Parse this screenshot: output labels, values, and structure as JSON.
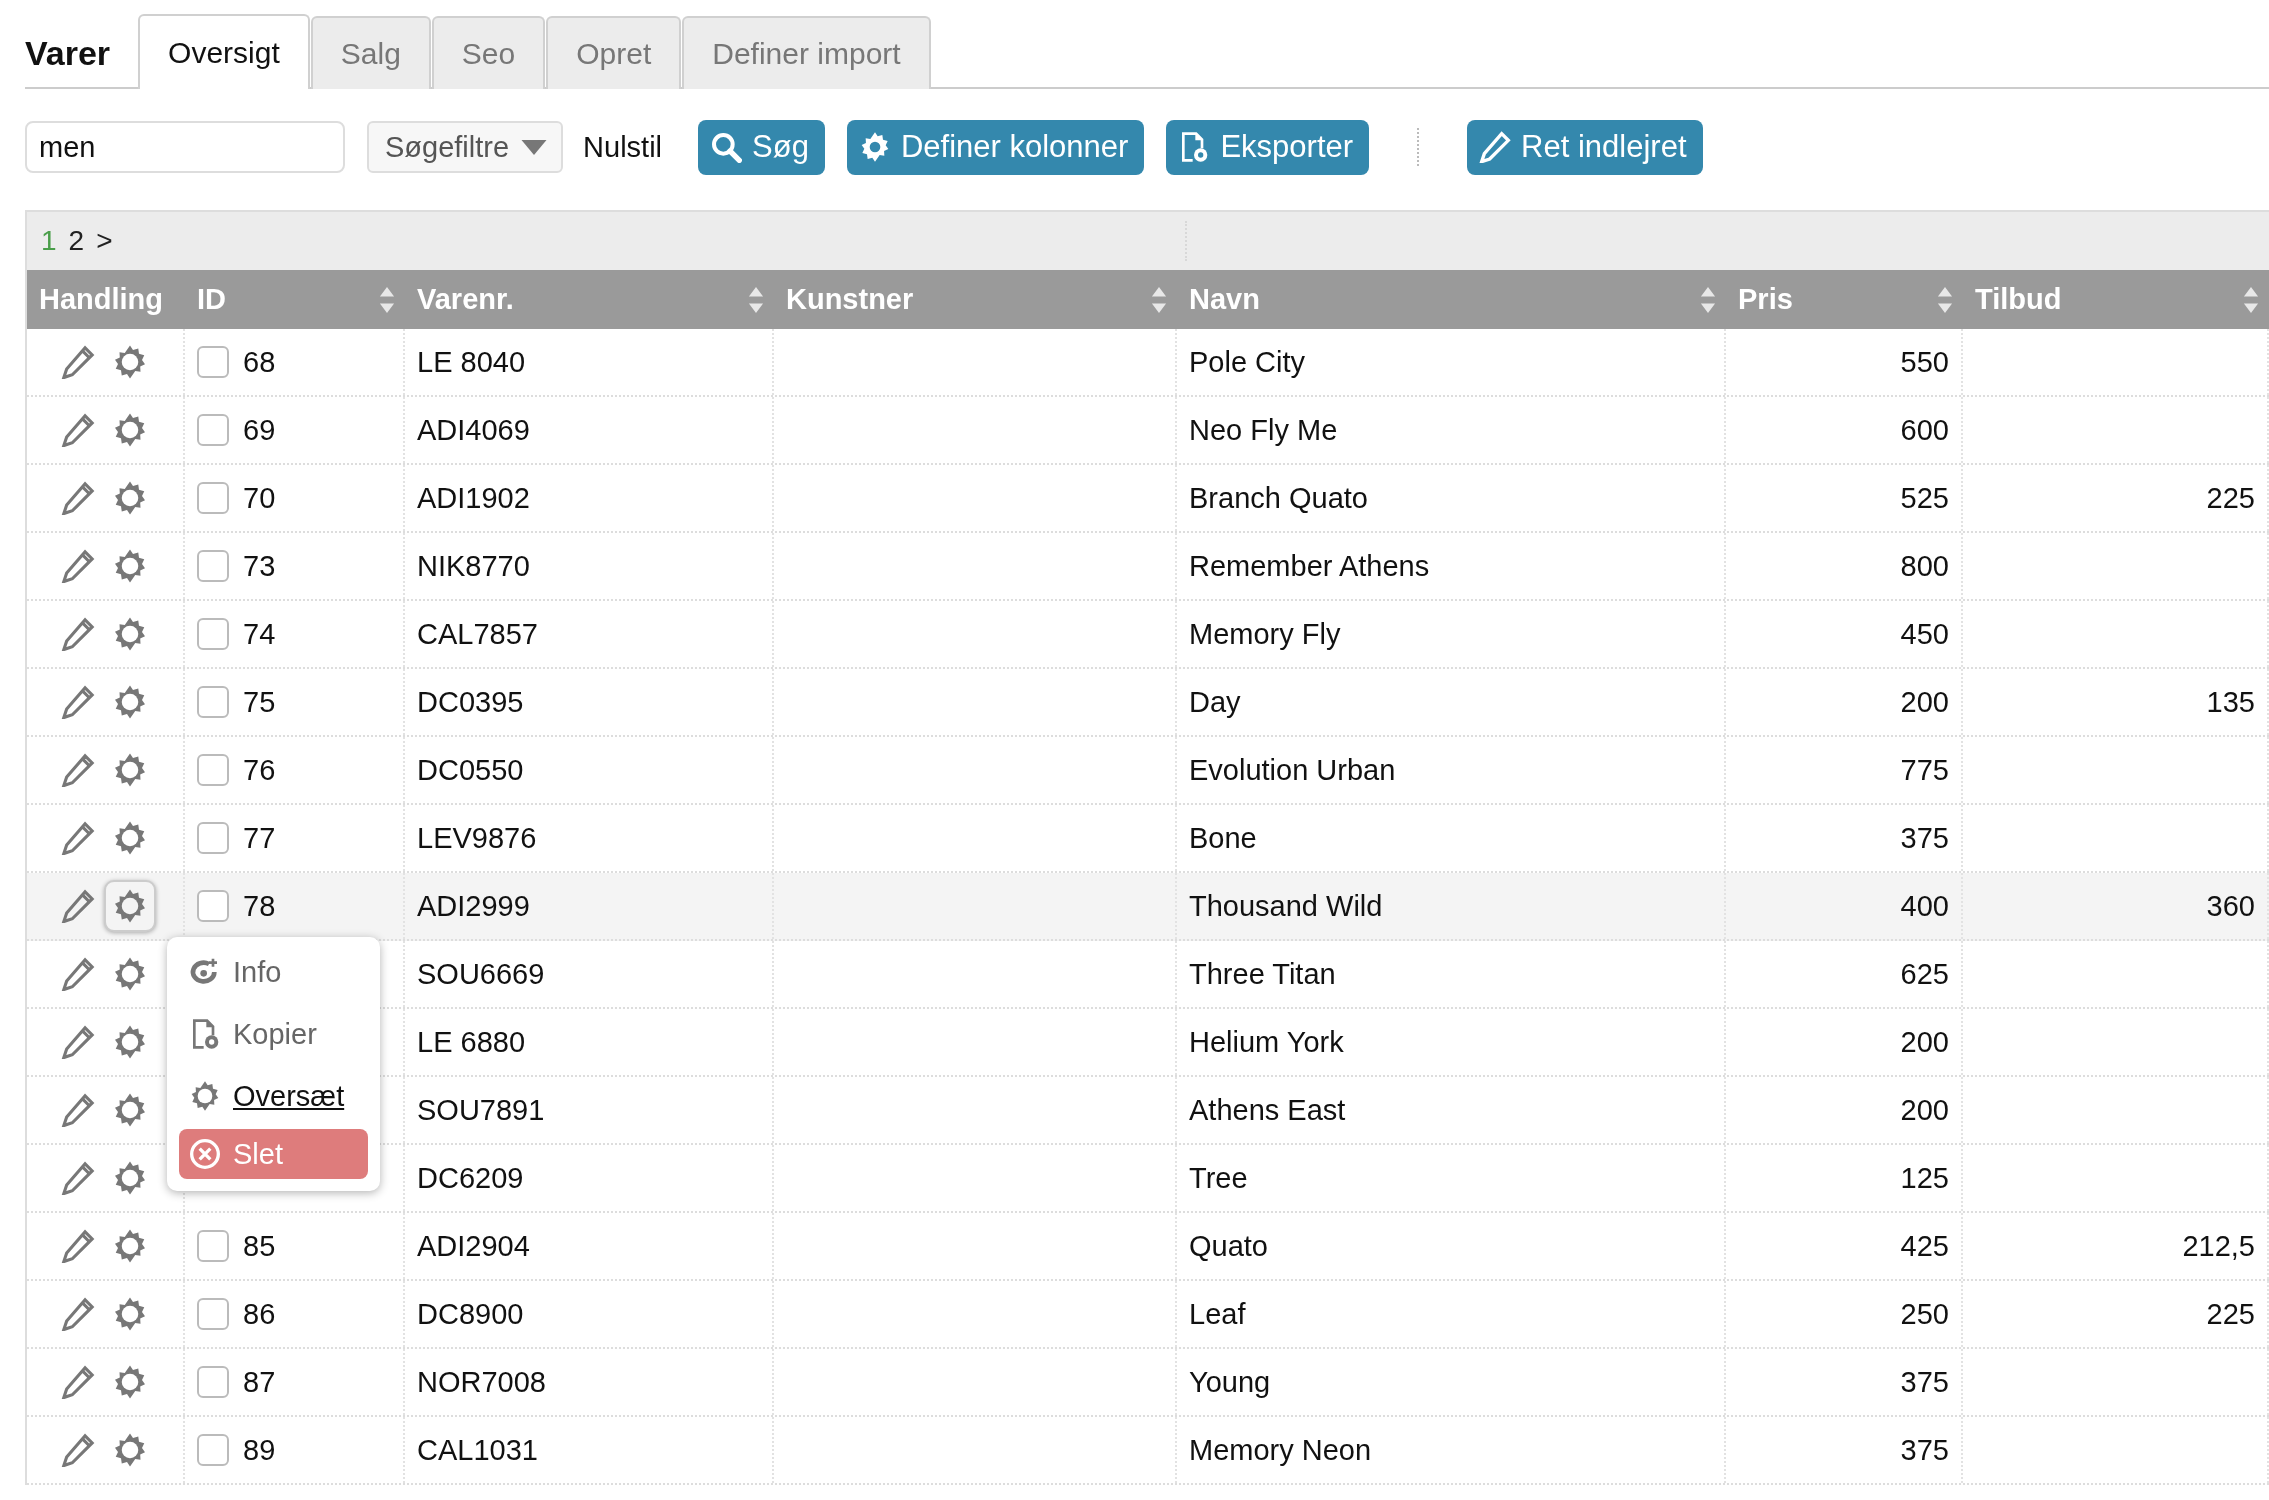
{
  "title": "Varer",
  "tabs": [
    {
      "label": "Oversigt",
      "selected": true
    },
    {
      "label": "Salg",
      "selected": false
    },
    {
      "label": "Seo",
      "selected": false
    },
    {
      "label": "Opret",
      "selected": false
    },
    {
      "label": "Definer import",
      "selected": false
    }
  ],
  "search": {
    "value": "men"
  },
  "filter_dropdown": {
    "label": "Søgefiltre"
  },
  "reset_link": "Nulstil",
  "buttons": [
    {
      "kind": "search",
      "label": "Søg"
    },
    {
      "kind": "columns",
      "label": "Definer kolonner"
    },
    {
      "kind": "export",
      "label": "Eksporter"
    },
    {
      "kind": "separator"
    },
    {
      "kind": "edit",
      "label": "Ret indlejret"
    }
  ],
  "pager": [
    {
      "label": "1",
      "selected": true
    },
    {
      "label": "2",
      "selected": false
    },
    {
      "label": ">",
      "selected": false
    }
  ],
  "columns": [
    {
      "label": "Handling",
      "sortable": false
    },
    {
      "label": "ID",
      "sortable": true
    },
    {
      "label": "Varenr.",
      "sortable": true
    },
    {
      "label": "Kunstner",
      "sortable": true
    },
    {
      "label": "Navn",
      "sortable": true
    },
    {
      "label": "Pris",
      "sortable": true
    },
    {
      "label": "Tilbud",
      "sortable": true
    }
  ],
  "rows": [
    {
      "id": "68",
      "varenr": "LE 8040",
      "navn": "Pole City",
      "pris": "550",
      "checked": false,
      "selected": false
    },
    {
      "id": "69",
      "varenr": "ADI4069",
      "navn": "Neo Fly Me",
      "pris": "600",
      "checked": false,
      "selected": false
    },
    {
      "id": "70",
      "varenr": "ADI1902",
      "navn": "Branch Quato",
      "pris": "525",
      "tilbud": "225",
      "checked": false,
      "selected": false
    },
    {
      "id": "73",
      "varenr": "NIK8770",
      "navn": "Remember Athens",
      "pris": "800",
      "checked": false,
      "selected": false
    },
    {
      "id": "74",
      "varenr": "CAL7857",
      "navn": "Memory Fly",
      "pris": "450",
      "checked": false,
      "selected": false
    },
    {
      "id": "75",
      "varenr": "DC0395",
      "navn": "Day",
      "pris": "200",
      "tilbud": "135",
      "checked": false,
      "selected": false
    },
    {
      "id": "76",
      "varenr": "DC0550",
      "navn": "Evolution Urban",
      "pris": "775",
      "checked": false,
      "selected": false
    },
    {
      "id": "77",
      "varenr": "LEV9876",
      "navn": "Bone",
      "pris": "375",
      "checked": false,
      "selected": false
    },
    {
      "id": "78",
      "varenr": "ADI2999",
      "navn": "Thousand Wild",
      "pris": "400",
      "tilbud": "360",
      "checked": false,
      "selected": true
    },
    {
      "varenr": "SOU6669",
      "navn": "Three Titan",
      "pris": "625",
      "selected": false
    },
    {
      "varenr": "LE 6880",
      "navn": "Helium York",
      "pris": "200",
      "selected": false
    },
    {
      "varenr": "SOU7891",
      "navn": "Athens East",
      "pris": "200",
      "selected": false
    },
    {
      "varenr": "DC6209",
      "navn": "Tree",
      "pris": "125",
      "selected": false
    },
    {
      "id": "85",
      "varenr": "ADI2904",
      "navn": "Quato",
      "pris": "425",
      "tilbud": "212,5",
      "checked": false,
      "selected": false
    },
    {
      "id": "86",
      "varenr": "DC8900",
      "navn": "Leaf",
      "pris": "250",
      "tilbud": "225",
      "checked": false,
      "selected": false
    },
    {
      "id": "87",
      "varenr": "NOR7008",
      "navn": "Young",
      "pris": "375",
      "checked": false,
      "selected": false
    },
    {
      "id": "89",
      "varenr": "CAL1031",
      "navn": "Memory Neon",
      "pris": "375",
      "checked": false,
      "selected": false
    }
  ],
  "context_menu": [
    {
      "kind": "info",
      "label": "Info",
      "hovered": false
    },
    {
      "kind": "copy",
      "label": "Kopier",
      "hovered": false
    },
    {
      "kind": "translate",
      "label": "Oversæt",
      "hovered": true
    },
    {
      "kind": "delete",
      "label": "Slet",
      "hovered": false
    }
  ]
}
